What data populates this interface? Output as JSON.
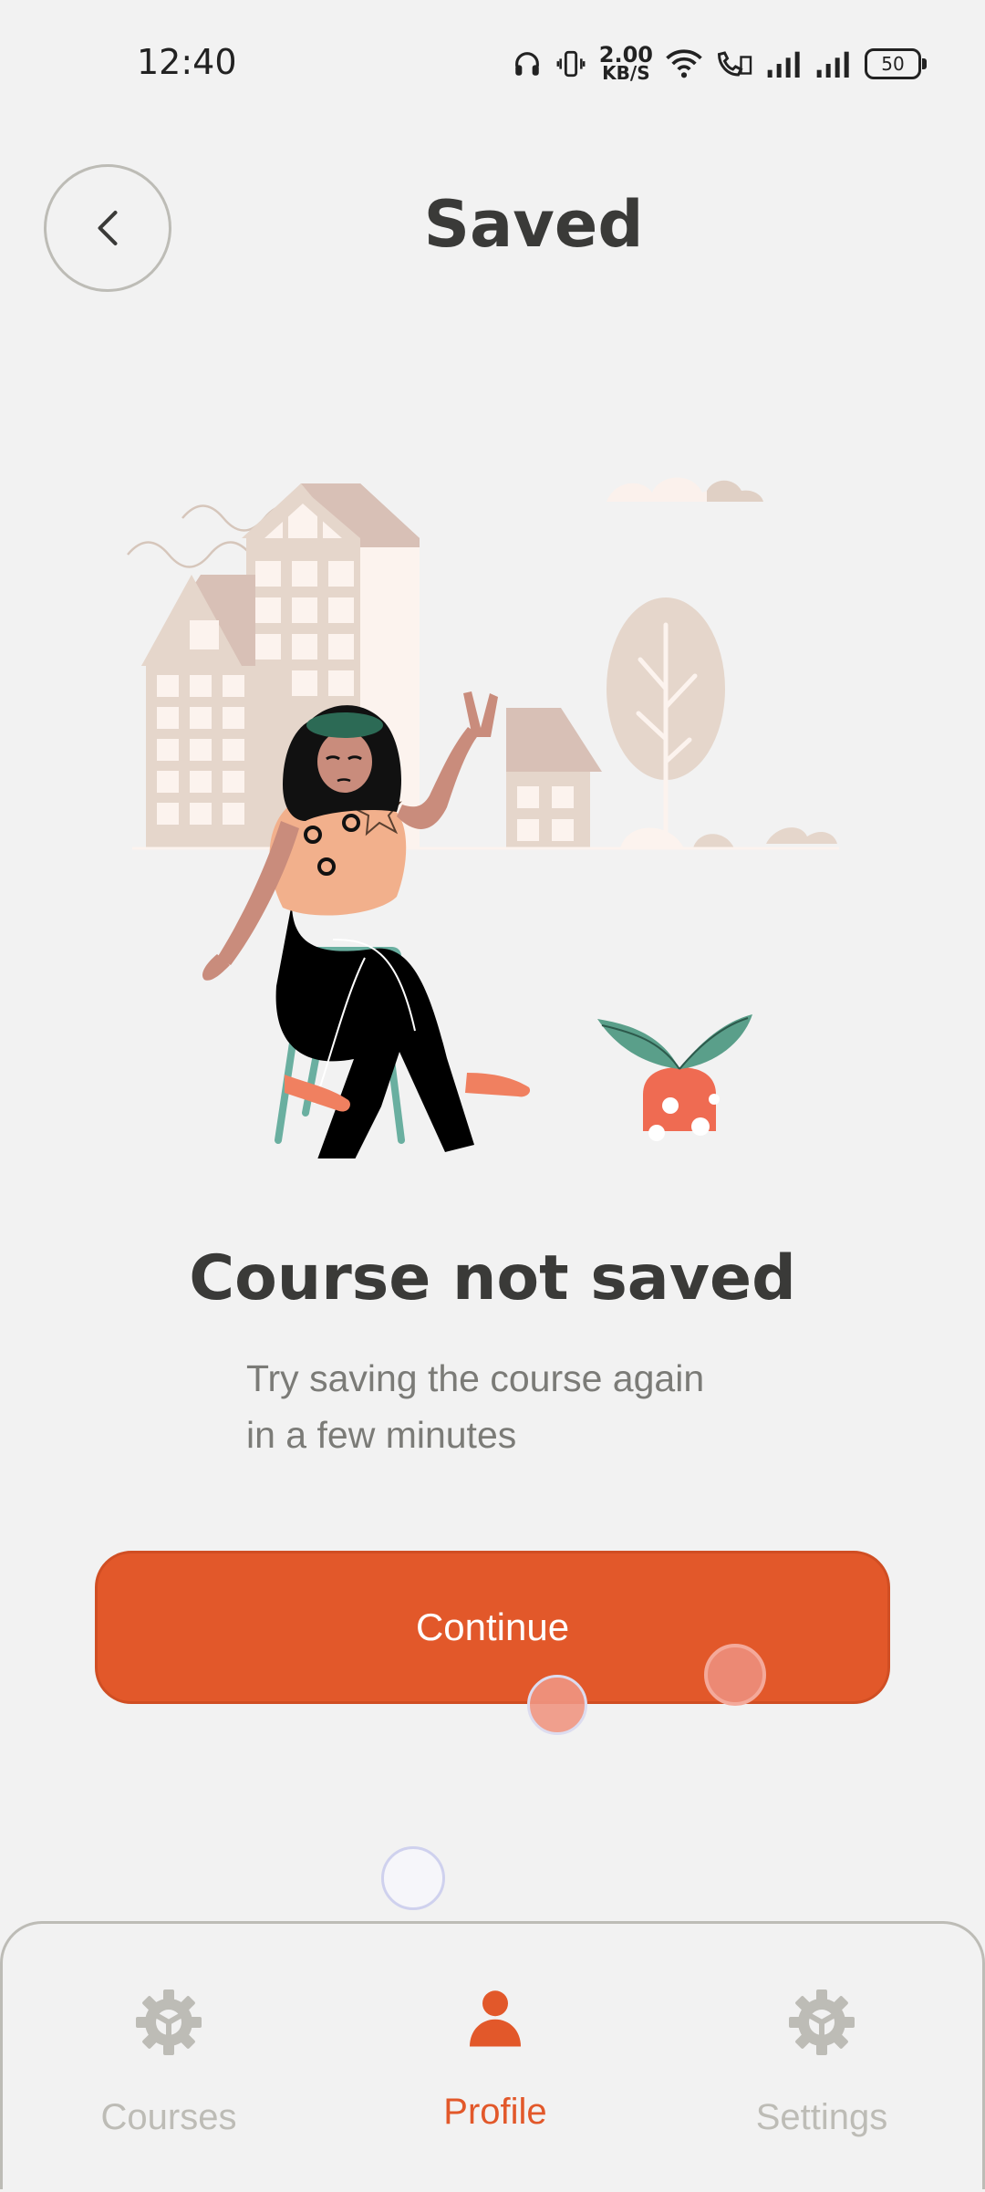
{
  "status_bar": {
    "time": "12:40",
    "net_speed_value": "2.00",
    "net_speed_unit": "KB/S",
    "battery": "50"
  },
  "header": {
    "title": "Saved",
    "back_icon": "chevron-left-icon"
  },
  "illustration": {
    "subject": "woman-sitting-on-chair-city-illustration"
  },
  "message": {
    "headline": "Course not saved",
    "subtitle_line1": "Try saving the course again",
    "subtitle_line2": "in a few minutes"
  },
  "actions": {
    "continue_label": "Continue"
  },
  "bottom_nav": {
    "items": [
      {
        "label": "Courses",
        "icon": "gear-icon",
        "active": false
      },
      {
        "label": "Profile",
        "icon": "person-icon",
        "active": true
      },
      {
        "label": "Settings",
        "icon": "gear-icon",
        "active": false
      }
    ]
  },
  "colors": {
    "accent": "#e2582a",
    "background": "#f2f2f2",
    "text": "#3a3a38",
    "muted": "#bdbcb6"
  }
}
